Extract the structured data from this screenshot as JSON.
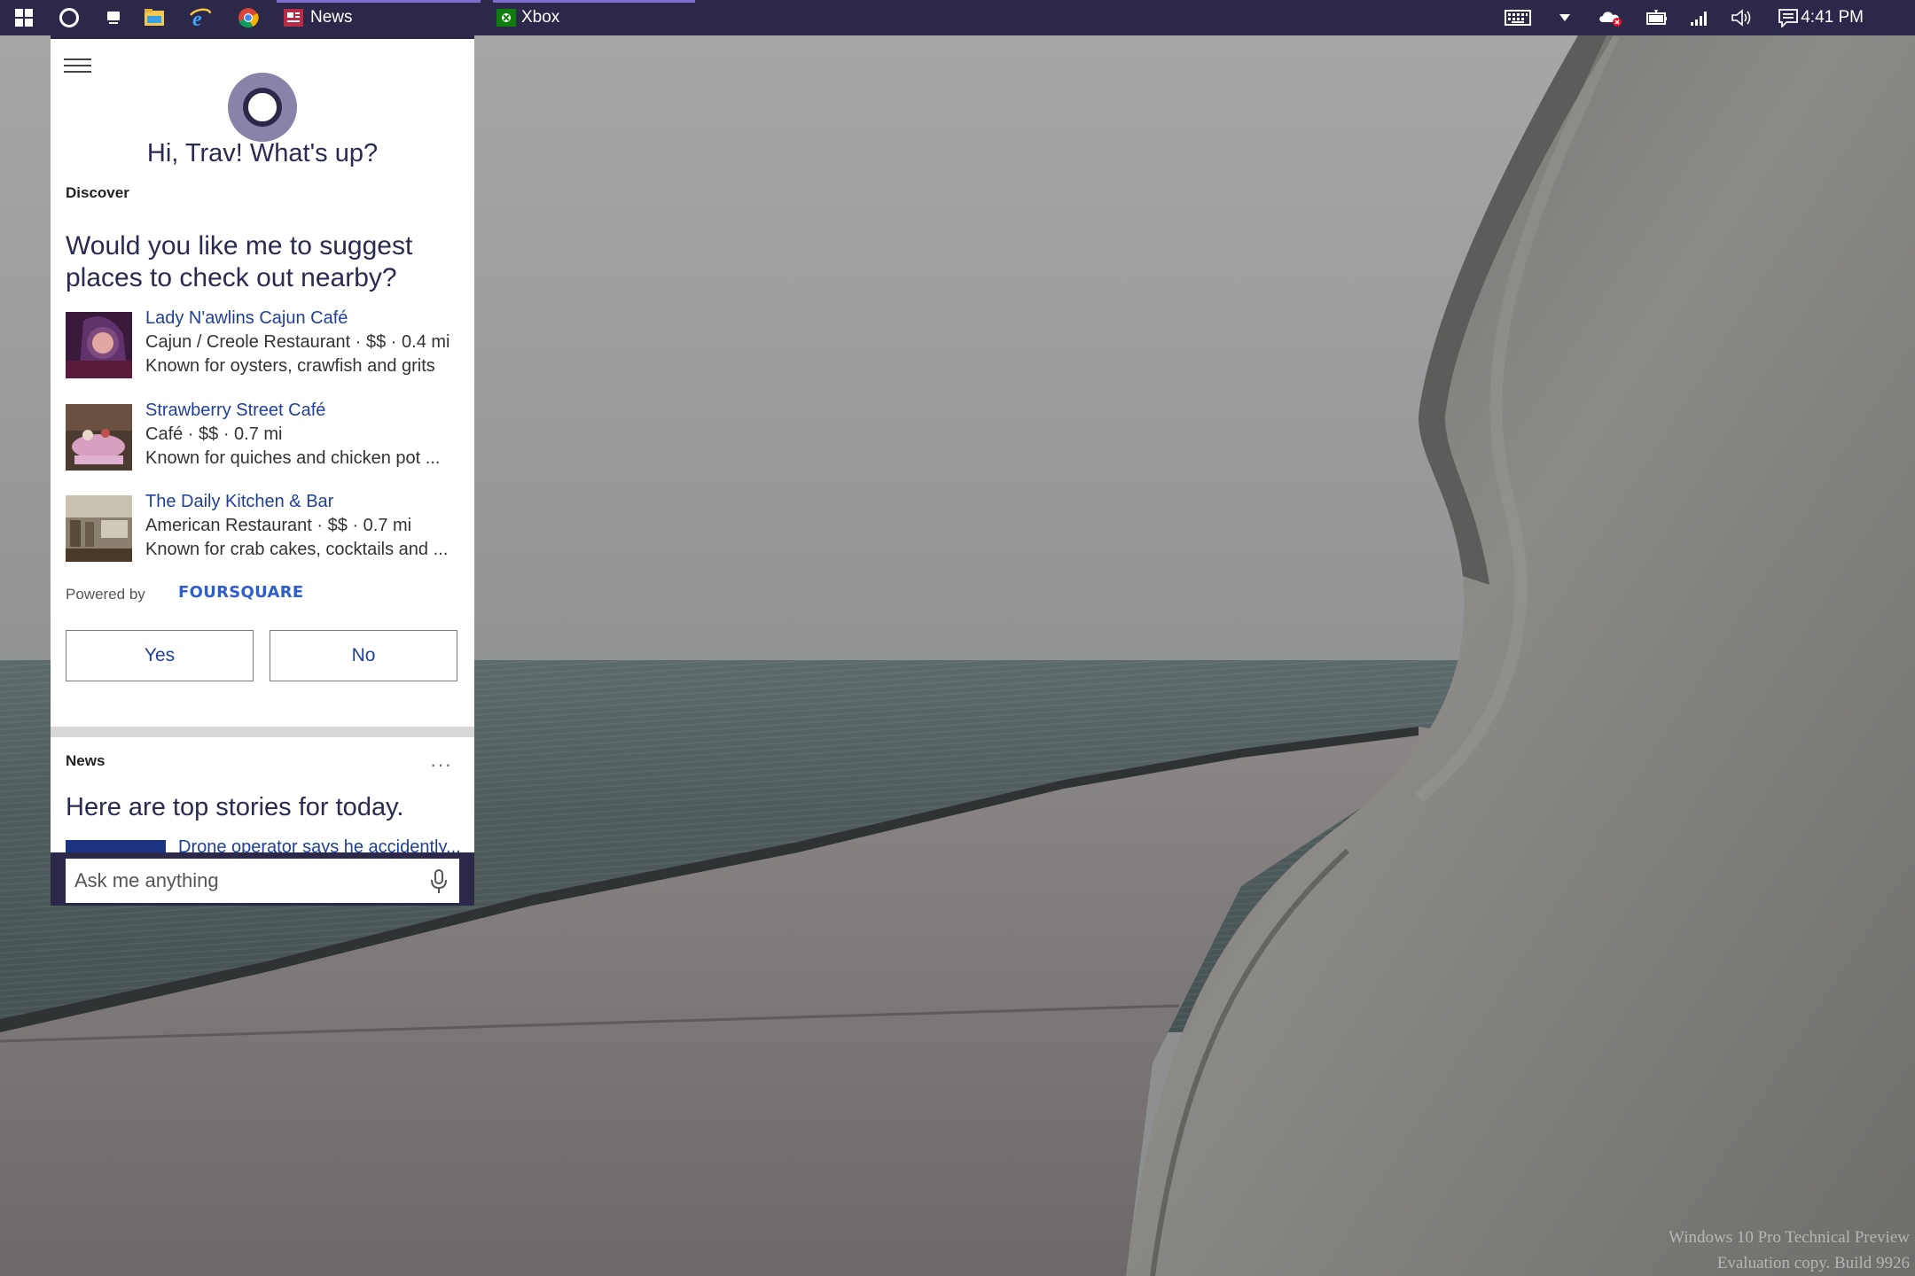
{
  "taskbar": {
    "apps": [
      {
        "label": "News"
      },
      {
        "label": "Xbox"
      }
    ],
    "clock": "4:41 PM"
  },
  "cortana": {
    "greeting": "Hi, Trav! What's up?",
    "discover": {
      "section_label": "Discover",
      "question": "Would you like me to suggest places to check out nearby?",
      "places": [
        {
          "name": "Lady N'awlins Cajun Café",
          "details": "Cajun / Creole Restaurant · $$ · 0.4 mi",
          "known_for": "Known for oysters, crawfish and grits"
        },
        {
          "name": "Strawberry Street Café",
          "details": "Café · $$ · 0.7 mi",
          "known_for": "Known for quiches and chicken pot ..."
        },
        {
          "name": "The Daily Kitchen & Bar",
          "details": "American Restaurant · $$ · 0.7 mi",
          "known_for": "Known for crab cakes, cocktails and ..."
        }
      ],
      "powered_by": "Powered by",
      "provider": "FOURSQUARE",
      "yes_label": "Yes",
      "no_label": "No"
    },
    "news": {
      "section_label": "News",
      "more": "···",
      "headline": "Here are top stories for today.",
      "first_story": "Drone operator says he accidently..."
    },
    "search": {
      "placeholder": "Ask me anything"
    }
  },
  "watermark": {
    "line1": "Windows 10 Pro Technical Preview",
    "line2": "Evaluation copy. Build 9926"
  },
  "colors": {
    "taskbar": "#2c2849",
    "accent": "#7d6fd0",
    "link": "#1f3f9a",
    "heading": "#2a2a52"
  }
}
